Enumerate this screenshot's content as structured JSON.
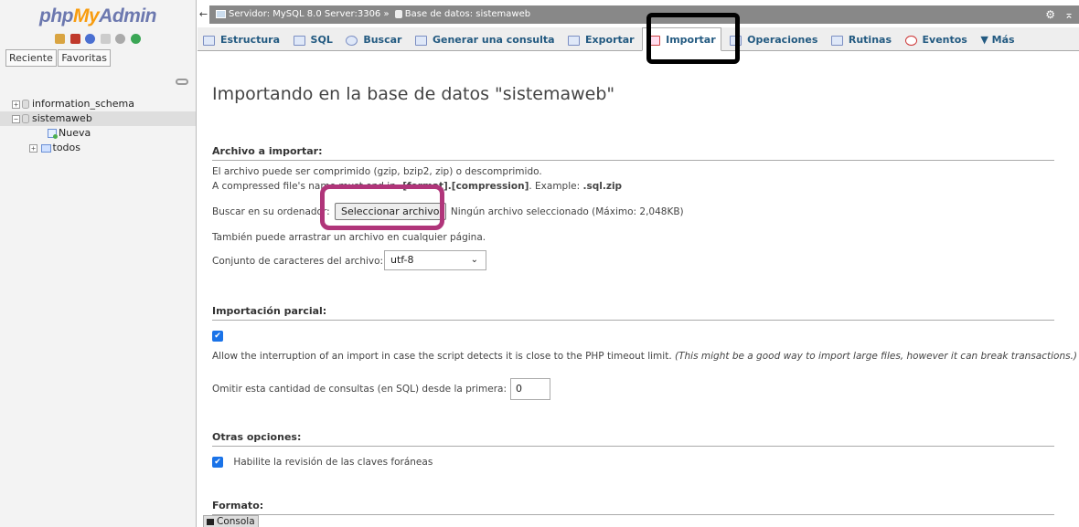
{
  "app": {
    "logo": {
      "php": "php",
      "my": "My",
      "admin": "Admin"
    }
  },
  "left_panel": {
    "tabs": [
      "Reciente",
      "Favoritas"
    ],
    "tree": [
      {
        "label": "information_schema",
        "expander": "+"
      },
      {
        "label": "sistemaweb",
        "expander": "−",
        "selected": true
      },
      {
        "label": "Nueva"
      },
      {
        "label": "todos",
        "expander": "+"
      }
    ]
  },
  "breadcrumb": {
    "server": "Servidor: MySQL 8.0 Server:3306",
    "separator": "»",
    "database": "Base de datos: sistemaweb"
  },
  "tabs": [
    {
      "label": "Estructura",
      "icon": "structure-icon"
    },
    {
      "label": "SQL",
      "icon": "sql-icon"
    },
    {
      "label": "Buscar",
      "icon": "search-icon"
    },
    {
      "label": "Generar una consulta",
      "icon": "query-icon"
    },
    {
      "label": "Exportar",
      "icon": "export-icon"
    },
    {
      "label": "Importar",
      "icon": "import-icon",
      "active": true
    },
    {
      "label": "Operaciones",
      "icon": "wrench-icon"
    },
    {
      "label": "Rutinas",
      "icon": "routines-icon"
    },
    {
      "label": "Eventos",
      "icon": "clock-icon"
    },
    {
      "label": "Más",
      "icon": "caret-down-icon"
    }
  ],
  "main": {
    "heading": "Importando en la base de datos \"sistemaweb\"",
    "file_section": {
      "title": "Archivo a importar:",
      "compress_note": "El archivo puede ser comprimido (gzip, bzip2, zip) o descomprimido.",
      "compressed_prefix": "A compressed file's name must end in ",
      "compressed_format": ".[format].[compression]",
      "compressed_example_label": ". Example: ",
      "compressed_example": ".sql.zip",
      "browse_label": "Buscar en su ordenador:",
      "browse_button": "Seleccionar archivo",
      "no_file": "Ningún archivo seleccionado",
      "max_size": "(Máximo: 2,048KB)",
      "drag_note": "También puede arrastrar un archivo en cualquier página.",
      "charset_label": "Conjunto de caracteres del archivo:",
      "charset_value": "utf-8"
    },
    "partial_section": {
      "title": "Importación parcial:",
      "interrupt_text": "Allow the interruption of an import in case the script detects it is close to the PHP timeout limit.",
      "interrupt_note": "(This might be a good way to import large files, however it can break transactions.)",
      "skip_label": "Omitir esta cantidad de consultas (en SQL) desde la primera:",
      "skip_value": "0"
    },
    "other_section": {
      "title": "Otras opciones:",
      "fk_label": "Habilite la revisión de las claves foráneas"
    },
    "format_section": {
      "title": "Formato:"
    }
  },
  "console": {
    "label": "Consola"
  },
  "colors": {
    "annotation_black": "#000000",
    "annotation_pink": "#b0357a",
    "tab_text": "#235a81",
    "checkbox": "#1a73e8"
  }
}
